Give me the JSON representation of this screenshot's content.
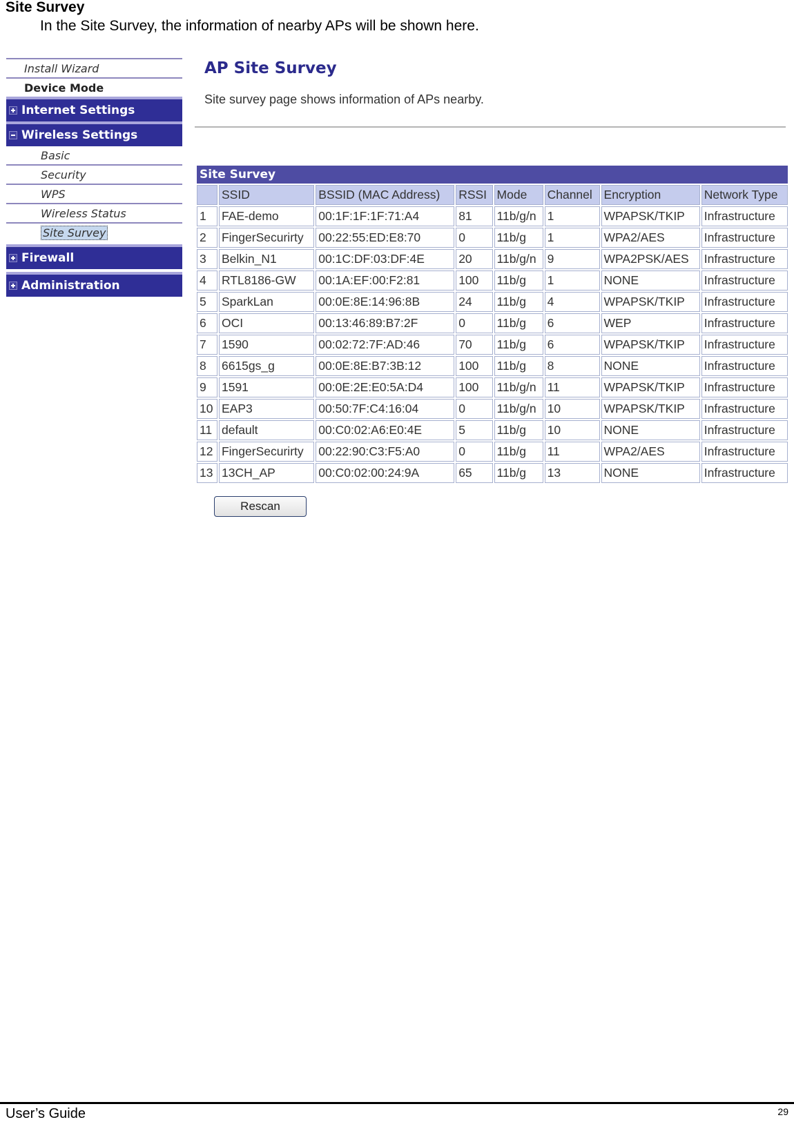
{
  "document": {
    "heading": "Site Survey",
    "intro": "In the Site Survey, the information of nearby APs will be shown here."
  },
  "sidebar": {
    "top_links": [
      {
        "label": "Install Wizard",
        "style": "italic"
      },
      {
        "label": "Device Mode",
        "style": "bold"
      }
    ],
    "groups": {
      "internet": {
        "label": "Internet Settings",
        "expander": "plus"
      },
      "wireless": {
        "label": "Wireless Settings",
        "expander": "minus"
      },
      "firewall": {
        "label": "Firewall",
        "expander": "plus"
      },
      "administration": {
        "label": "Administration",
        "expander": "plus"
      }
    },
    "wireless_items": [
      {
        "label": "Basic"
      },
      {
        "label": "Security"
      },
      {
        "label": "WPS"
      },
      {
        "label": "Wireless Status"
      },
      {
        "label": "Site Survey",
        "active": true
      }
    ]
  },
  "main": {
    "title": "AP Site Survey",
    "description": "Site survey page shows information of APs nearby.",
    "table_title": "Site Survey",
    "columns": [
      "",
      "SSID",
      "BSSID (MAC Address)",
      "RSSI",
      "Mode",
      "Channel",
      "Encryption",
      "Network Type"
    ],
    "rows": [
      [
        "1",
        "FAE-demo",
        "00:1F:1F:1F:71:A4",
        "81",
        "11b/g/n",
        "1",
        "WPAPSK/TKIP",
        "Infrastructure"
      ],
      [
        "2",
        "FingerSecurirty",
        "00:22:55:ED:E8:70",
        "0",
        "11b/g",
        "1",
        "WPA2/AES",
        "Infrastructure"
      ],
      [
        "3",
        "Belkin_N1",
        "00:1C:DF:03:DF:4E",
        "20",
        "11b/g/n",
        "9",
        "WPA2PSK/AES",
        "Infrastructure"
      ],
      [
        "4",
        "RTL8186-GW",
        "00:1A:EF:00:F2:81",
        "100",
        "11b/g",
        "1",
        "NONE",
        "Infrastructure"
      ],
      [
        "5",
        "SparkLan",
        "00:0E:8E:14:96:8B",
        "24",
        "11b/g",
        "4",
        "WPAPSK/TKIP",
        "Infrastructure"
      ],
      [
        "6",
        "OCI",
        "00:13:46:89:B7:2F",
        "0",
        "11b/g",
        "6",
        "WEP",
        "Infrastructure"
      ],
      [
        "7",
        "1590",
        "00:02:72:7F:AD:46",
        "70",
        "11b/g",
        "6",
        "WPAPSK/TKIP",
        "Infrastructure"
      ],
      [
        "8",
        "6615gs_g",
        "00:0E:8E:B7:3B:12",
        "100",
        "11b/g",
        "8",
        "NONE",
        "Infrastructure"
      ],
      [
        "9",
        "1591",
        "00:0E:2E:E0:5A:D4",
        "100",
        "11b/g/n",
        "11",
        "WPAPSK/TKIP",
        "Infrastructure"
      ],
      [
        "10",
        "EAP3",
        "00:50:7F:C4:16:04",
        "0",
        "11b/g/n",
        "10",
        "WPAPSK/TKIP",
        "Infrastructure"
      ],
      [
        "11",
        "default",
        "00:C0:02:A6:E0:4E",
        "5",
        "11b/g",
        "10",
        "NONE",
        "Infrastructure"
      ],
      [
        "12",
        "FingerSecurirty",
        "00:22:90:C3:F5:A0",
        "0",
        "11b/g",
        "11",
        "WPA2/AES",
        "Infrastructure"
      ],
      [
        "13",
        "13CH_AP",
        "00:C0:02:00:24:9A",
        "65",
        "11b/g",
        "13",
        "NONE",
        "Infrastructure"
      ]
    ],
    "rescan_label": "Rescan"
  },
  "footer": {
    "left": "User’s Guide",
    "page_number": "29"
  }
}
